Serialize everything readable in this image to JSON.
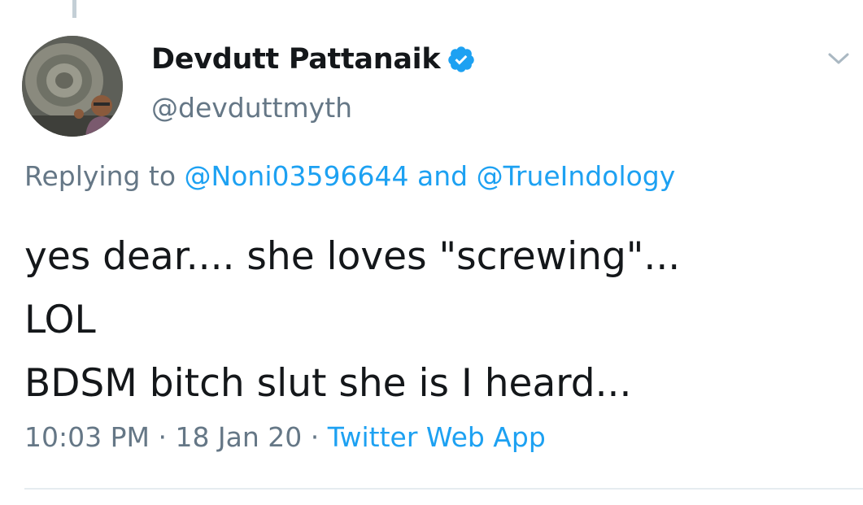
{
  "tweet": {
    "author": {
      "display_name": "Devdutt Pattanaik",
      "handle": "@devduttmyth",
      "verified": true
    },
    "replying": {
      "prefix": "Replying to ",
      "mention_1": "@Noni03596644",
      "conjunction": " and ",
      "mention_2": "@TrueIndology"
    },
    "text_lines": [
      "yes dear.... she loves \"screwing\"...",
      "LOL",
      "BDSM bitch slut she is I heard..."
    ],
    "meta": {
      "time": "10:03 PM",
      "separator": " · ",
      "date": "18 Jan 20",
      "source": "Twitter Web App"
    }
  },
  "icons": {
    "verified": "verified-badge-icon",
    "menu": "chevron-down-icon"
  },
  "colors": {
    "link": "#1da1f2",
    "secondary_text": "#657786",
    "primary_text": "#14171a",
    "divider": "#e6ecf0"
  }
}
